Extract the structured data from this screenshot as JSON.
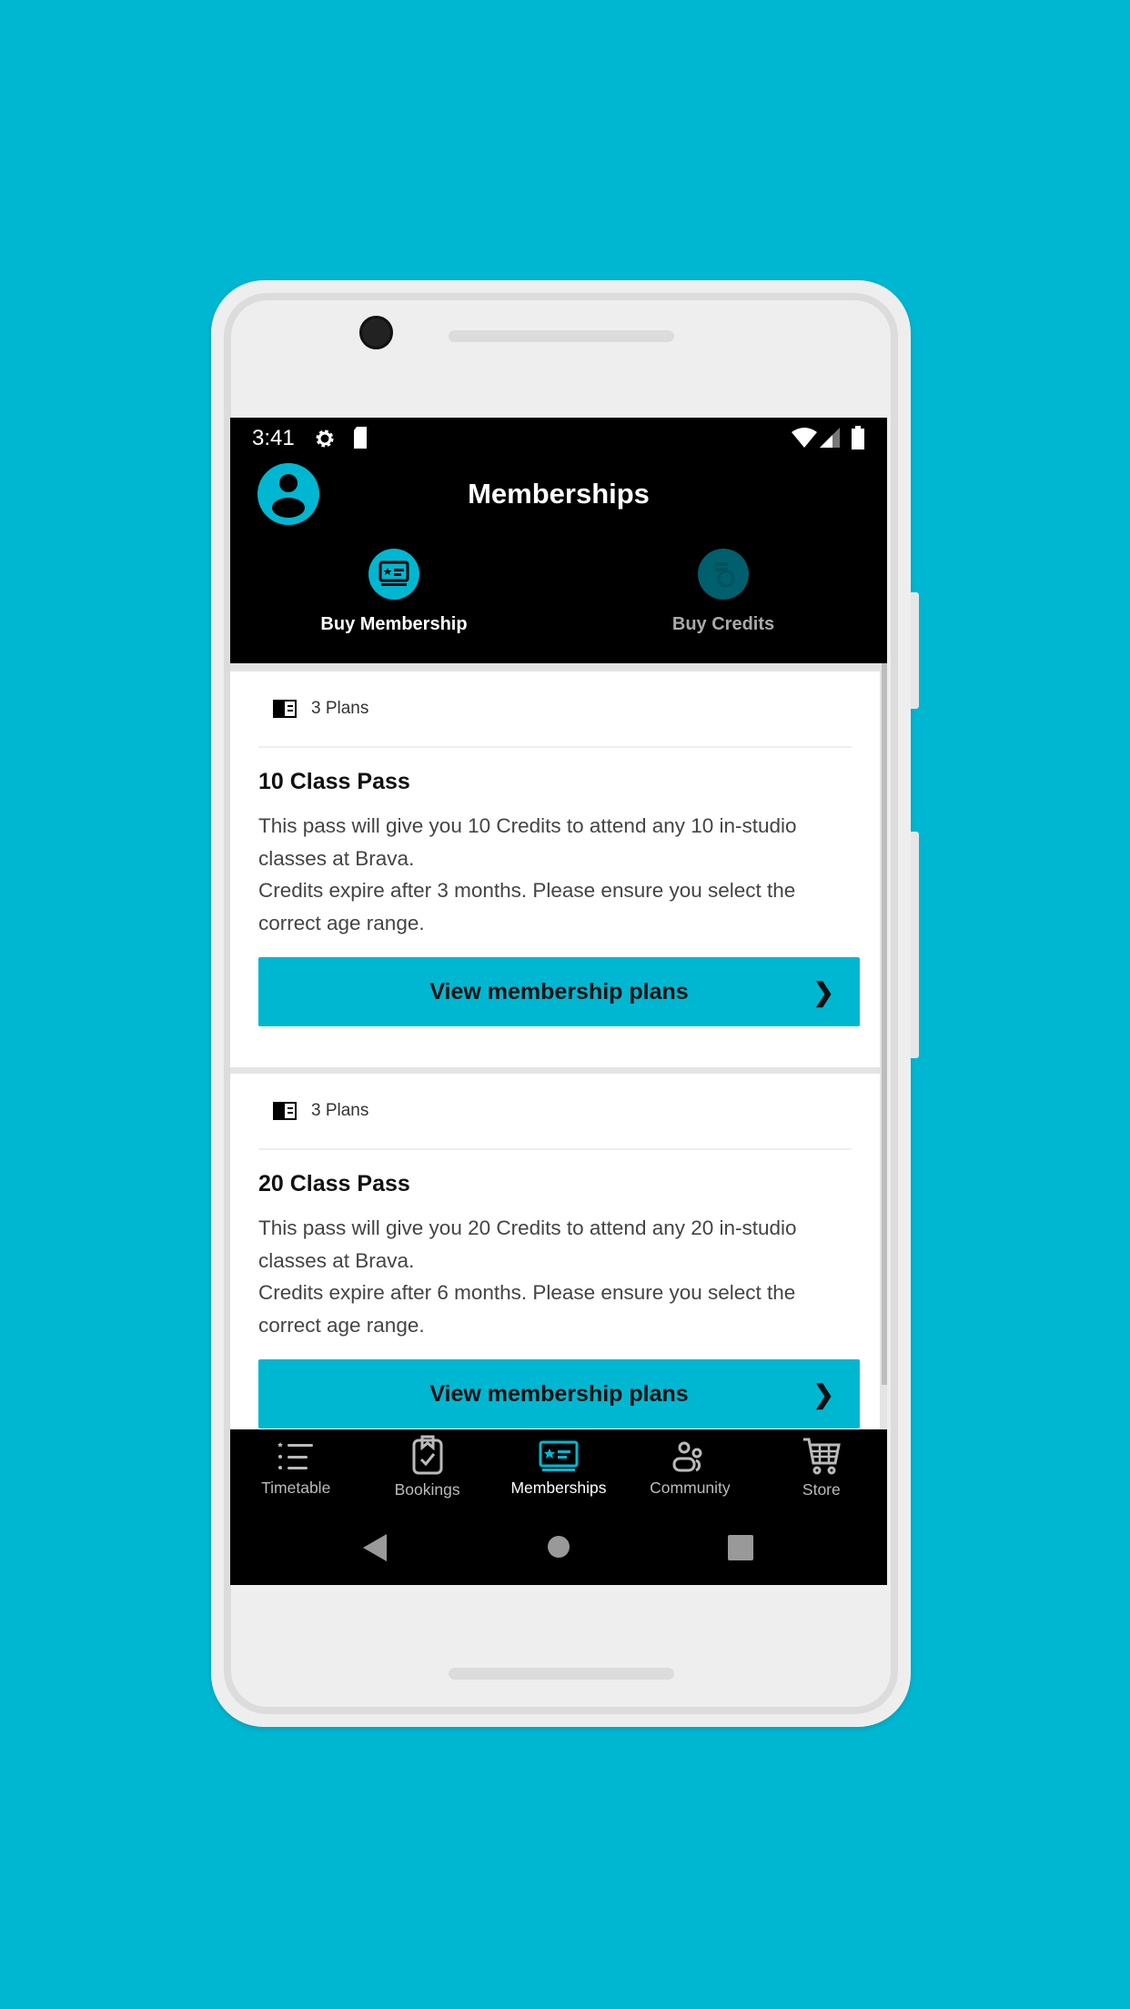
{
  "status_bar": {
    "time": "3:41",
    "icons": [
      "gear-icon",
      "sd-card-icon",
      "wifi-icon",
      "signal-icon",
      "battery-icon"
    ]
  },
  "header": {
    "title": "Memberships",
    "avatar_icon": "user-icon"
  },
  "tabs": [
    {
      "label": "Buy Membership",
      "icon": "membership-card-icon",
      "active": true
    },
    {
      "label": "Buy Credits",
      "icon": "credits-icon",
      "active": false
    }
  ],
  "cards": [
    {
      "plans": "3 Plans",
      "title": "10 Class Pass",
      "description": [
        "This pass will give you 10 Credits to attend any 10 in-studio classes at Brava.",
        "Credits expire after 3 months. Please ensure you select the correct age range."
      ],
      "button": "View membership plans"
    },
    {
      "plans": "3 Plans",
      "title": "20 Class Pass",
      "description": [
        "This pass will give you 20 Credits to attend any 20 in-studio classes at Brava.",
        "Credits expire after 6 months. Please ensure you select the correct age range."
      ],
      "button": "View membership plans"
    }
  ],
  "bottom_nav": [
    {
      "label": "Timetable",
      "icon": "list-icon"
    },
    {
      "label": "Bookings",
      "icon": "clipboard-check-icon"
    },
    {
      "label": "Memberships",
      "icon": "membership-card-icon",
      "active": true
    },
    {
      "label": "Community",
      "icon": "people-icon"
    },
    {
      "label": "Store",
      "icon": "cart-icon"
    }
  ],
  "colors": {
    "accent": "#00b7d1",
    "background": "#00b7d1",
    "header": "#000000"
  }
}
